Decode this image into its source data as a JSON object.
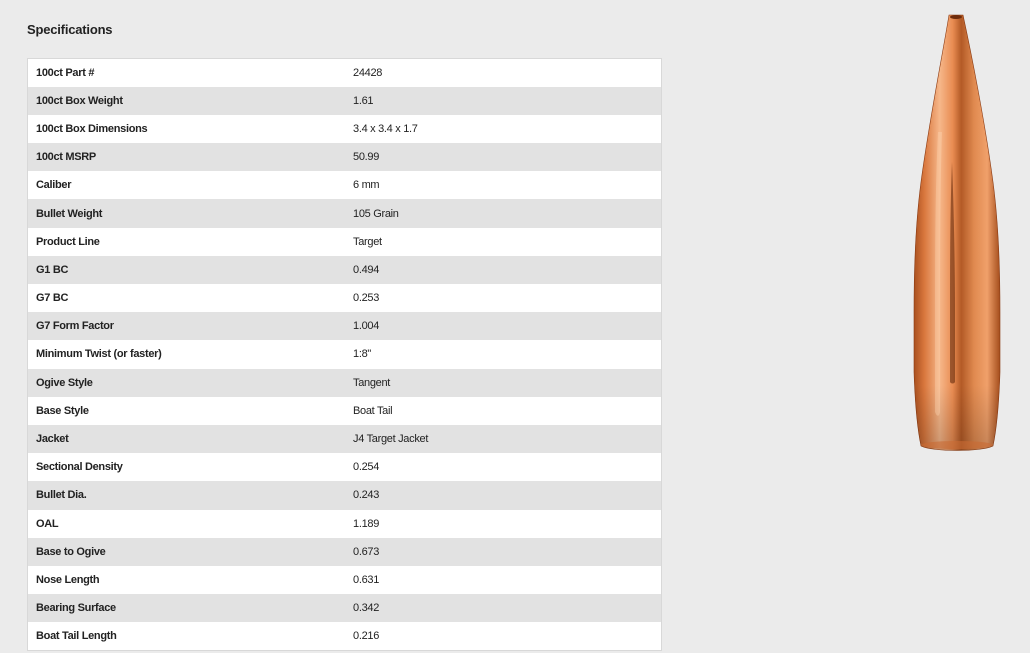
{
  "section": {
    "title": "Specifications"
  },
  "specs": [
    {
      "label": "100ct Part #",
      "value": "24428"
    },
    {
      "label": "100ct Box Weight",
      "value": "1.61"
    },
    {
      "label": "100ct Box Dimensions",
      "value": "3.4 x 3.4 x 1.7"
    },
    {
      "label": "100ct MSRP",
      "value": "50.99"
    },
    {
      "label": "Caliber",
      "value": "6 mm"
    },
    {
      "label": "Bullet Weight",
      "value": "105 Grain"
    },
    {
      "label": "Product Line",
      "value": "Target"
    },
    {
      "label": "G1 BC",
      "value": "0.494"
    },
    {
      "label": "G7 BC",
      "value": "0.253"
    },
    {
      "label": "G7 Form Factor",
      "value": "1.004"
    },
    {
      "label": "Minimum Twist (or faster)",
      "value": "1:8\""
    },
    {
      "label": "Ogive Style",
      "value": "Tangent"
    },
    {
      "label": "Base Style",
      "value": "Boat Tail"
    },
    {
      "label": "Jacket",
      "value": "J4 Target Jacket"
    },
    {
      "label": "Sectional Density",
      "value": "0.254"
    },
    {
      "label": "Bullet Dia.",
      "value": "0.243"
    },
    {
      "label": "OAL",
      "value": "1.189"
    },
    {
      "label": "Base to Ogive",
      "value": "0.673"
    },
    {
      "label": "Nose Length",
      "value": "0.631"
    },
    {
      "label": "Bearing Surface",
      "value": "0.342"
    },
    {
      "label": "Boat Tail Length",
      "value": "0.216"
    }
  ],
  "colors": {
    "background": "#ebebeb",
    "row_alt": "#e2e2e2",
    "row": "#ffffff",
    "copper_light": "#f3b184",
    "copper_mid": "#d9773d",
    "copper_dark": "#8a3a12"
  },
  "image": {
    "name": "bullet-image"
  }
}
